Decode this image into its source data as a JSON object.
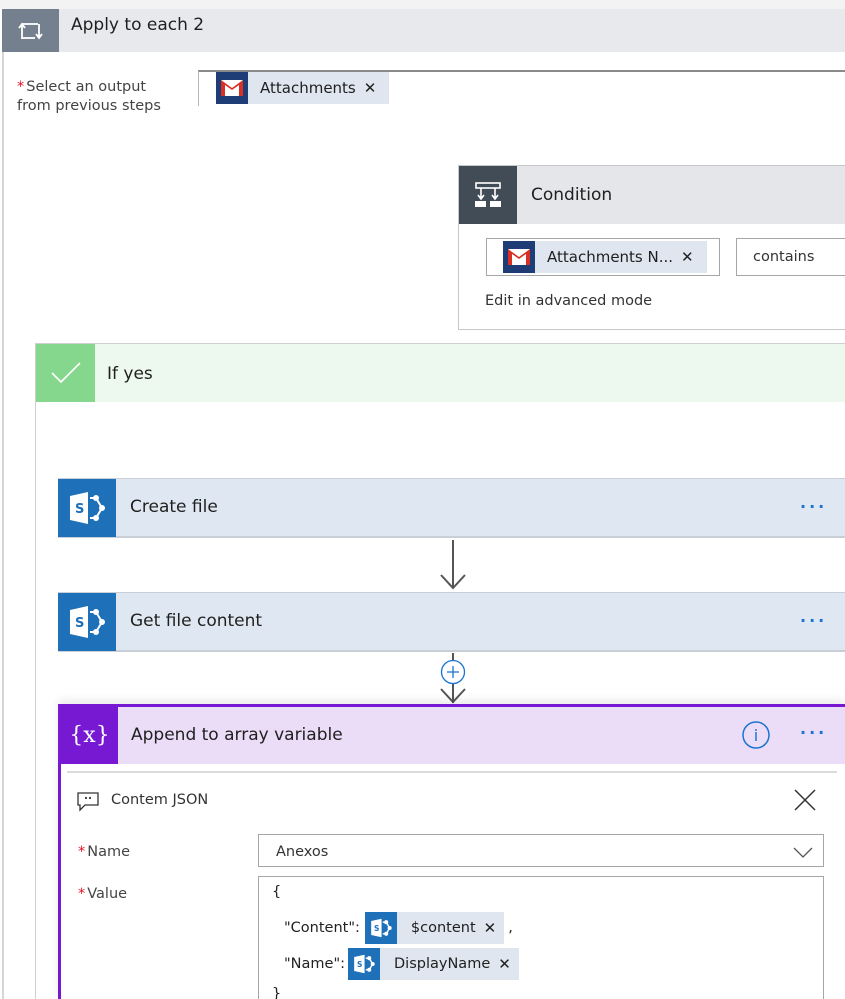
{
  "loop": {
    "title": "Apply to each 2",
    "icon": "loop-icon",
    "select_output_label_line1": "Select an output",
    "select_output_label_line2": "from previous steps",
    "required_marker": "*",
    "token": {
      "icon": "gmail-icon",
      "label": "Attachments",
      "remove": "✕"
    }
  },
  "condition": {
    "title": "Condition",
    "icon": "condition-icon",
    "left_token": {
      "icon": "gmail-icon",
      "label": "Attachments N...",
      "remove": "✕"
    },
    "operator": "contains",
    "advanced_link": "Edit in advanced mode"
  },
  "if_yes": {
    "title": "If yes",
    "icon": "check-icon",
    "color": "#86d78e"
  },
  "actions": [
    {
      "title": "Create file",
      "icon": "sharepoint-icon",
      "menu": "···"
    },
    {
      "title": "Get file content",
      "icon": "sharepoint-icon",
      "menu": "···"
    }
  ],
  "append": {
    "title": "Append to array variable",
    "icon": "variable-icon",
    "icon_text": "{x}",
    "info": "i",
    "menu": "···",
    "comment": "Contem JSON",
    "close": "✕",
    "name_label": "Name",
    "name_value": "Anexos",
    "value_label": "Value",
    "required_marker": "*",
    "value_lines": {
      "open_brace": "{",
      "content_key": "\"Content\":",
      "content_token": "$content",
      "content_suffix": ",",
      "name_key": "\"Name\":",
      "name_token": "DisplayName",
      "close_brace": "}",
      "remove": "✕"
    }
  },
  "colors": {
    "accent_blue": "#1a73d0",
    "sharepoint": "#1e70b8",
    "variable_purple": "#7719d3",
    "required_red": "#e81123"
  }
}
